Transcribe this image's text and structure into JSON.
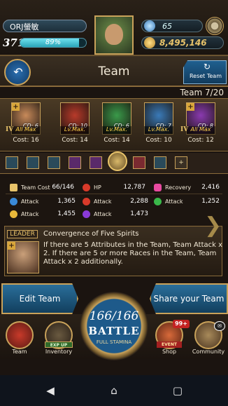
{
  "player": {
    "name": "ORJ螢敏",
    "level": "371",
    "exp_percent_label": "89%",
    "exp_fraction": 0.89
  },
  "resources": {
    "gems": "65",
    "coins": "8,495,146"
  },
  "header": {
    "title": "Team",
    "reset_label": "Reset Team",
    "team_count": "Team 7/20"
  },
  "members": [
    {
      "cd": "CD: 6",
      "badge": "All Max",
      "cost": "Cost: 16",
      "roman": "IV",
      "plus": true,
      "color": "#c88a5a"
    },
    {
      "cd": "CD: 10",
      "badge": "Lv.Max.",
      "cost": "Cost: 14",
      "roman": "",
      "plus": false,
      "color": "#b83a2a"
    },
    {
      "cd": "CD: 6",
      "badge": "Lv.Max.",
      "cost": "Cost: 14",
      "roman": "",
      "plus": false,
      "color": "#3a9a4a"
    },
    {
      "cd": "CD: 7",
      "badge": "Lv.Max.",
      "cost": "Cost: 10",
      "roman": "",
      "plus": false,
      "color": "#3a7ab8"
    },
    {
      "cd": "CD: 8",
      "badge": "All Max",
      "cost": "Cost: 12",
      "roman": "IV",
      "plus": true,
      "color": "#8a3ab0"
    }
  ],
  "slots": [
    {
      "kind": "blue"
    },
    {
      "kind": "blue"
    },
    {
      "kind": "blue"
    },
    {
      "kind": "purple"
    },
    {
      "kind": "purple"
    },
    {
      "kind": "red"
    },
    {
      "kind": "blue"
    },
    {
      "kind": "add",
      "glyph": "+"
    }
  ],
  "stats": {
    "team_cost_label": "Team Cost",
    "team_cost_value": "66/146",
    "hp_label": "HP",
    "hp_value": "12,787",
    "recovery_label": "Recovery",
    "recovery_value": "2,416",
    "rows": [
      {
        "label": "Attack",
        "value": "1,365",
        "color": "#3a8ad8"
      },
      {
        "label": "Attack",
        "value": "2,288",
        "color": "#d83a2a"
      },
      {
        "label": "Attack",
        "value": "1,252",
        "color": "#3ab84a"
      },
      {
        "label": "Attack",
        "value": "1,455",
        "color": "#e8b83a"
      },
      {
        "label": "Attack",
        "value": "1,473",
        "color": "#8a3ad8"
      }
    ]
  },
  "leader": {
    "tag": "LEADER",
    "skill_name": "Convergence of Five Spirits",
    "description": "If there are 5 Attributes in the Team, Team Attack x 2. If there are 5 or more Races in the Team, Team Attack x 2 additionally."
  },
  "actions": {
    "edit_team": "Edit Team",
    "share_team": "Share your Team"
  },
  "battle": {
    "stamina": "166/166",
    "label": "BATTLE",
    "sub": "FULL STAMINA"
  },
  "nav": {
    "team": "Team",
    "inventory": "Inventory",
    "exp_up": "EXP UP",
    "shop": "Shop",
    "event": "EVENT",
    "shop_badge": "99+",
    "community": "Community"
  },
  "colors": {
    "accent_gold": "#c9a25a",
    "button_blue": "#2a6e9a"
  }
}
